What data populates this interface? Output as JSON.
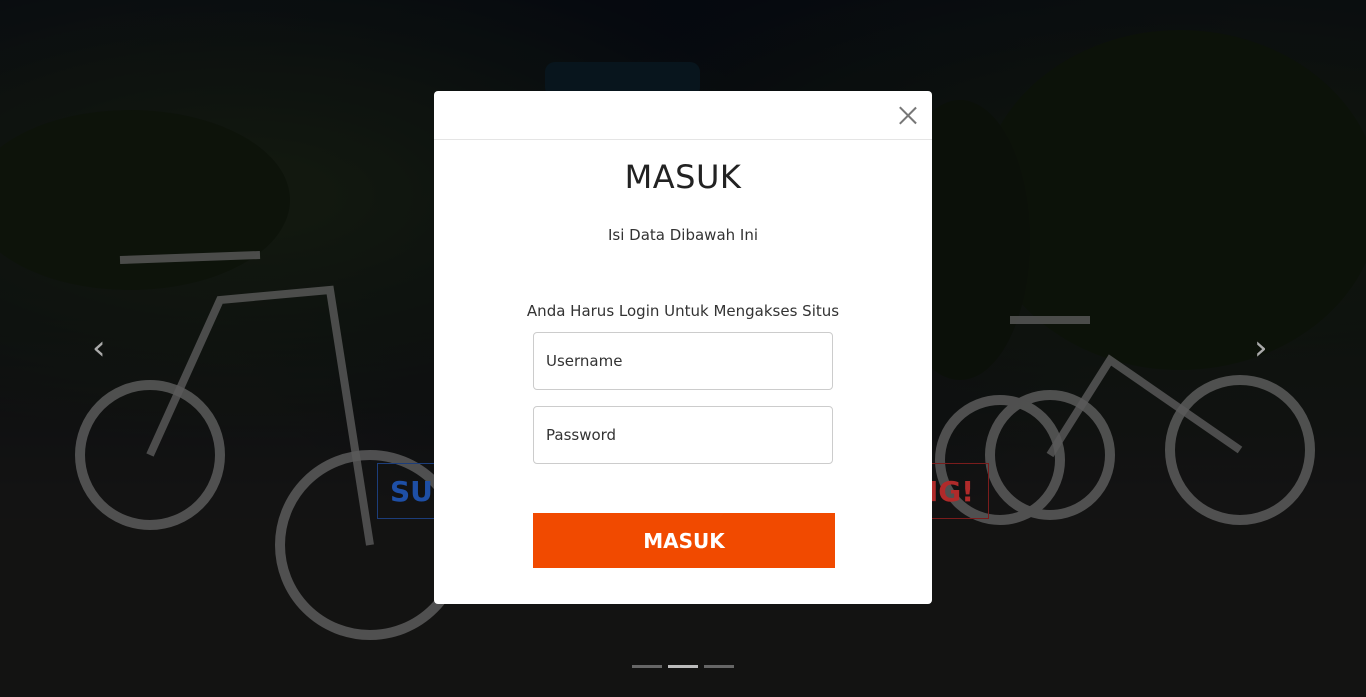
{
  "hero": {
    "promo_left_text": "SUD",
    "promo_right_text": "NG!",
    "prev_icon": "chevron-left-icon",
    "next_icon": "chevron-right-icon",
    "prev_glyph": "‹",
    "next_glyph": "›",
    "indicator_count": 3,
    "active_indicator": 2
  },
  "modal": {
    "close_icon": "close-icon",
    "title": "MASUK",
    "subtitle": "Isi Data Dibawah Ini",
    "notice": "Anda Harus Login Untuk Mengakses Situs",
    "username_placeholder": "Username",
    "password_placeholder": "Password",
    "submit_label": "MASUK"
  },
  "colors": {
    "accent": "#f14a00",
    "promo_blue": "#1e4fa6",
    "promo_red": "#b02a2a"
  }
}
